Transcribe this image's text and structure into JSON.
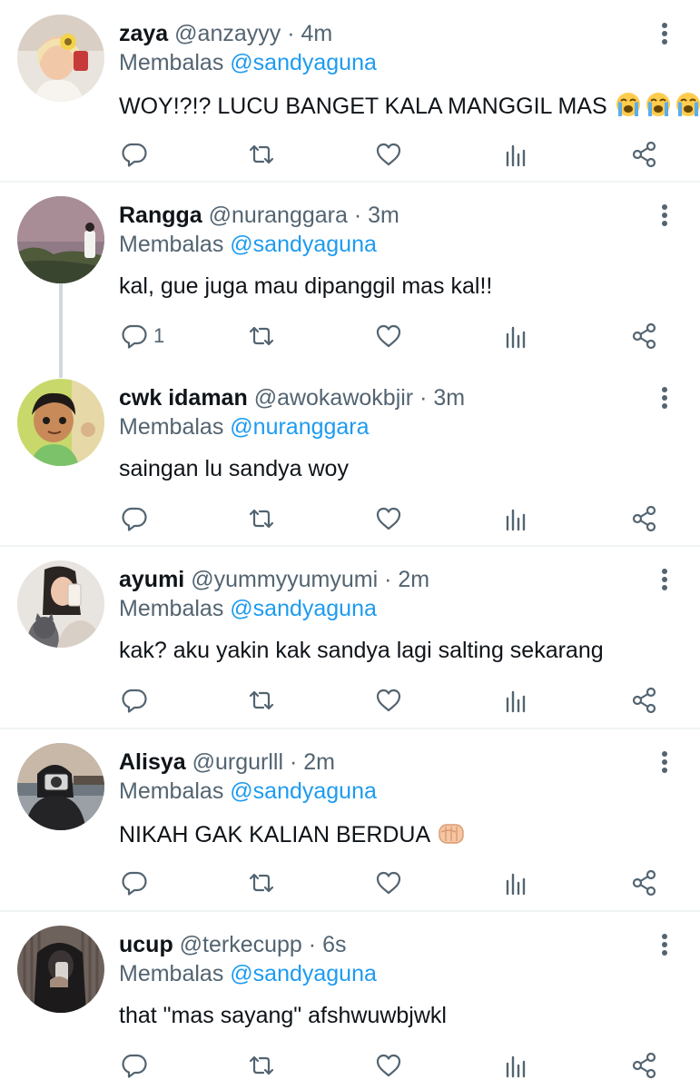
{
  "reply_prefix": "Membalas",
  "separator": "·",
  "icons": {
    "reply": "reply-icon",
    "retweet": "retweet-icon",
    "like": "heart-icon",
    "views": "views-icon",
    "share": "share-icon",
    "more": "more-options-icon"
  },
  "colors": {
    "link": "#1d9bf0",
    "muted": "#536471",
    "text": "#0f1419",
    "divider": "#eff3f4"
  },
  "tweets": [
    {
      "name": "zaya",
      "handle": "@anzayyy",
      "time": "4m",
      "reply_to": "@sandyaguna",
      "text": "WOY!?!? LUCU BANGET KALA MANGGIL MAS",
      "emoji": "loudly-crying-face x3",
      "reply_count": ""
    },
    {
      "name": "Rangga",
      "handle": "@nuranggara",
      "time": "3m",
      "reply_to": "@sandyaguna",
      "text": "kal, gue juga mau dipanggil mas kal!!",
      "reply_count": "1"
    },
    {
      "name": "cwk idaman",
      "handle": "@awokawokbjir",
      "time": "3m",
      "reply_to": "@nuranggara",
      "text": "saingan lu sandya woy",
      "reply_count": ""
    },
    {
      "name": "ayumi",
      "handle": "@yummyyumyumi",
      "time": "2m",
      "reply_to": "@sandyaguna",
      "text": "kak? aku yakin kak sandya lagi salting sekarang",
      "reply_count": ""
    },
    {
      "name": "Alisya",
      "handle": "@urgurlll",
      "time": "2m",
      "reply_to": "@sandyaguna",
      "text": "NIKAH GAK KALIAN BERDUA",
      "emoji": "fist",
      "reply_count": ""
    },
    {
      "name": "ucup",
      "handle": "@terkecupp",
      "time": "6s",
      "reply_to": "@sandyaguna",
      "text": "that \"mas sayang\" afshwuwbjwkl",
      "reply_count": ""
    }
  ]
}
